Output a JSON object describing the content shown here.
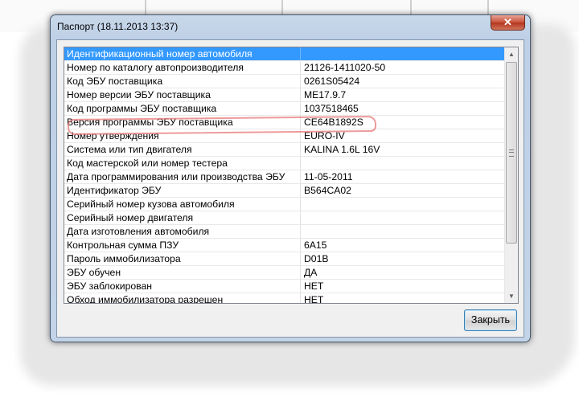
{
  "window": {
    "title": "Паспорт (18.11.2013 13:37)",
    "close_glyph": "✕"
  },
  "table": {
    "rows": [
      {
        "name": "Идентификационный номер автомобиля",
        "value": "",
        "selected": true
      },
      {
        "name": "Номер по каталогу автопроизводителя",
        "value": "21126-1411020-50"
      },
      {
        "name": "Код ЭБУ поставщика",
        "value": "0261S05424"
      },
      {
        "name": "Номер версии ЭБУ поставщика",
        "value": "ME17.9.7"
      },
      {
        "name": "Код программы ЭБУ поставщика",
        "value": "1037518465"
      },
      {
        "name": "Версия программы ЭБУ поставщика",
        "value": "CE64B1892S"
      },
      {
        "name": "Номер утверждения",
        "value": "EURO-IV"
      },
      {
        "name": "Система или тип двигателя",
        "value": "KALINA 1.6L 16V"
      },
      {
        "name": "Код мастерской или номер тестера",
        "value": ""
      },
      {
        "name": "Дата программирования или производства ЭБУ",
        "value": "11-05-2011"
      },
      {
        "name": "Идентификатор ЭБУ",
        "value": "B564CA02"
      },
      {
        "name": "Серийный номер кузова автомобиля",
        "value": ""
      },
      {
        "name": "Серийный номер двигателя",
        "value": ""
      },
      {
        "name": "Дата изготовления автомобиля",
        "value": ""
      },
      {
        "name": "Контрольная сумма ПЗУ",
        "value": "6A15"
      },
      {
        "name": "Пароль иммобилизатора",
        "value": "D01B"
      },
      {
        "name": "ЭБУ обучен",
        "value": "ДА"
      },
      {
        "name": "ЭБУ заблокирован",
        "value": "НЕТ"
      },
      {
        "name": "Обход иммобилизатора разрешен",
        "value": "НЕТ"
      }
    ],
    "highlighted_row": "Номер версии ЭБУ поставщика"
  },
  "scrollbar": {
    "up_icon": "up-arrow-icon",
    "down_icon": "down-arrow-icon"
  },
  "buttons": {
    "close_label": "Закрыть"
  },
  "colors": {
    "selection": "#3399ff",
    "marker": "#e87878",
    "close_button_title": "#c7503a"
  }
}
